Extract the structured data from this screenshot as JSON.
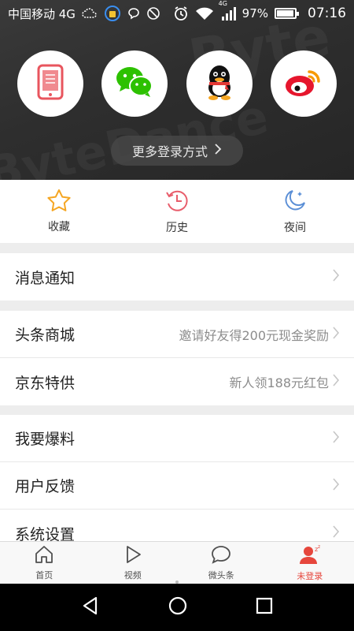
{
  "status_bar": {
    "carrier": "中国移动 4G",
    "network_label": "4G",
    "battery_percent": "97%",
    "battery_level": 0.97,
    "time": "07:16"
  },
  "login": {
    "options": [
      {
        "icon": "phone-icon"
      },
      {
        "icon": "wechat-icon"
      },
      {
        "icon": "qq-icon"
      },
      {
        "icon": "weibo-icon"
      }
    ],
    "more_label": "更多登录方式"
  },
  "quick_actions": [
    {
      "label": "收藏",
      "icon": "star-icon"
    },
    {
      "label": "历史",
      "icon": "history-clock-icon"
    },
    {
      "label": "夜间",
      "icon": "moon-icon"
    }
  ],
  "menu": {
    "notifications": {
      "title": "消息通知"
    },
    "mall": {
      "title": "头条商城",
      "subtitle": "邀请好友得200元现金奖励"
    },
    "jd": {
      "title": "京东特供",
      "subtitle": "新人领188元红包"
    },
    "tipoff": {
      "title": "我要爆料"
    },
    "feedback": {
      "title": "用户反馈"
    },
    "settings": {
      "title": "系统设置"
    }
  },
  "tabs": [
    {
      "label": "首页",
      "icon": "home-icon"
    },
    {
      "label": "视频",
      "icon": "play-icon"
    },
    {
      "label": "微头条",
      "icon": "chat-bubble-icon"
    },
    {
      "label": "未登录",
      "icon": "user-sleep-icon"
    }
  ],
  "colors": {
    "accent": "#e6463c",
    "quick_icon_star": "#f5a623",
    "quick_icon_history": "#e85d6b",
    "quick_icon_moon": "#5b8fd6"
  }
}
